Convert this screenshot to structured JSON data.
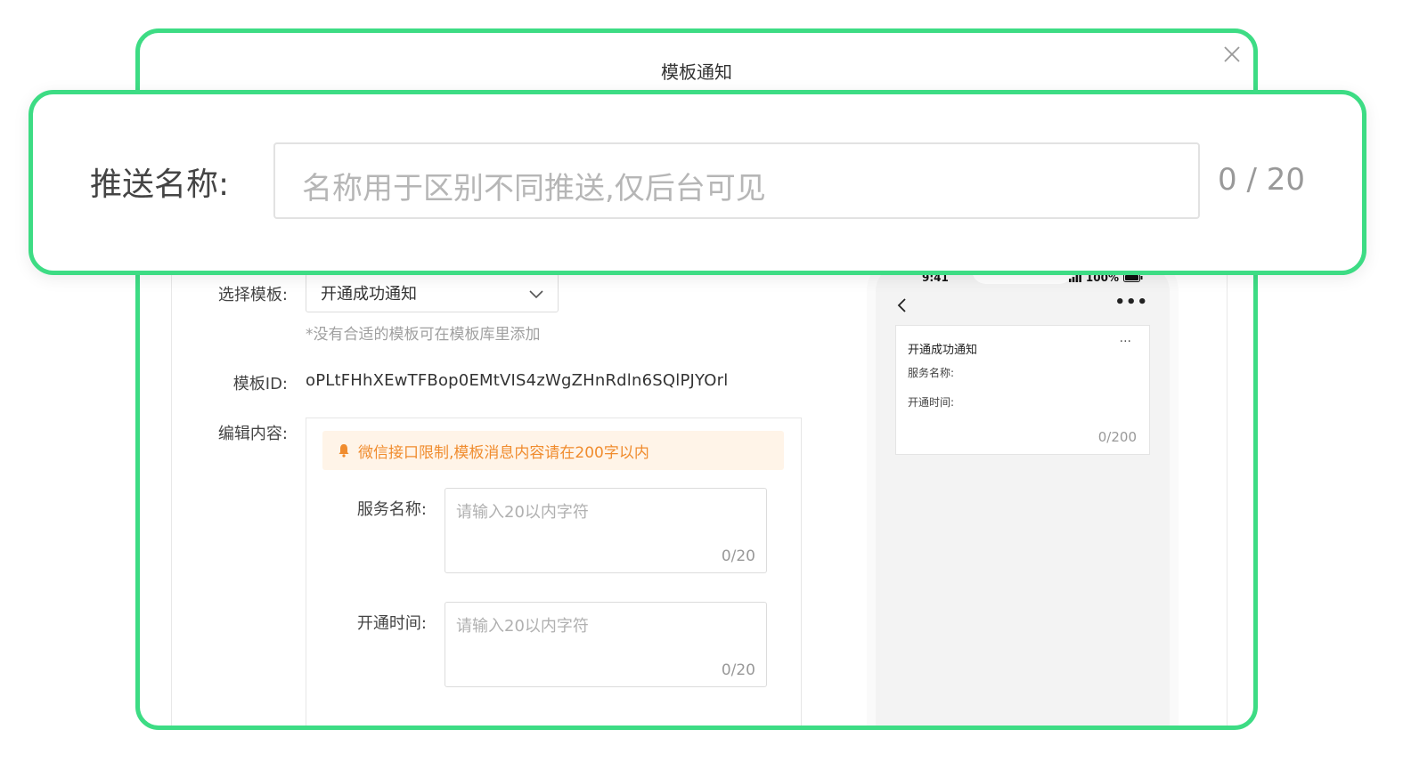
{
  "modal": {
    "title": "模板通知",
    "close_icon": "close-icon"
  },
  "push_name": {
    "label": "推送名称:",
    "placeholder": "名称用于区别不同推送,仅后台可见",
    "count": "0 / 20"
  },
  "template_select": {
    "label": "选择模板:",
    "value": "开通成功通知",
    "hint": "*没有合适的模板可在模板库里添加"
  },
  "template_id": {
    "label": "模板ID:",
    "value": "oPLtFHhXEwTFBop0EMtVIS4zWgZHnRdln6SQlPJYOrl"
  },
  "editor": {
    "label": "编辑内容:",
    "warning": "微信接口限制,模板消息内容请在200字以内",
    "fields": [
      {
        "label": "服务名称:",
        "placeholder": "请输入20以内字符",
        "count": "0/20"
      },
      {
        "label": "开通时间:",
        "placeholder": "请输入20以内字符",
        "count": "0/20"
      }
    ]
  },
  "preview": {
    "time": "9:41",
    "battery": "100%",
    "card_title": "开通成功通知",
    "field1": "服务名称:",
    "field2": "开通时间:",
    "count": "0/200"
  },
  "colors": {
    "highlight": "#3ddc84",
    "warning_text": "#f08c2e",
    "warning_bg": "#fff4e8"
  }
}
